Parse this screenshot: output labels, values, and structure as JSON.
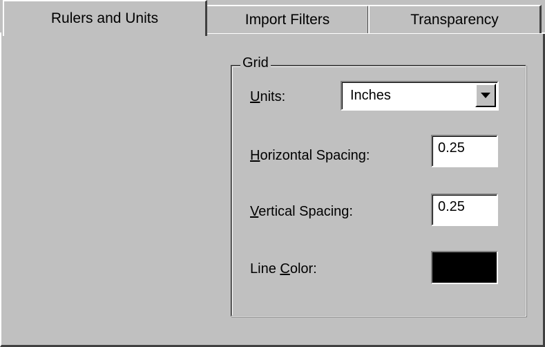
{
  "tabs": [
    {
      "label": "Rulers and Units",
      "active": true
    },
    {
      "label": "Import Filters",
      "active": false
    },
    {
      "label": "Transparency",
      "active": false
    }
  ],
  "grid": {
    "title": "Grid",
    "units": {
      "mnemonic": "U",
      "rest": "nits:",
      "value": "Inches"
    },
    "horizontal_spacing": {
      "mnemonic": "H",
      "rest": "orizontal Spacing:",
      "value": "0.25"
    },
    "vertical_spacing": {
      "mnemonic": "V",
      "rest": "ertical Spacing:",
      "value": "0.25"
    },
    "line_color": {
      "before": "Line ",
      "mnemonic": "C",
      "rest": "olor:",
      "color": "#000000"
    }
  },
  "icons": {
    "dropdown": "chevron-down-icon"
  }
}
